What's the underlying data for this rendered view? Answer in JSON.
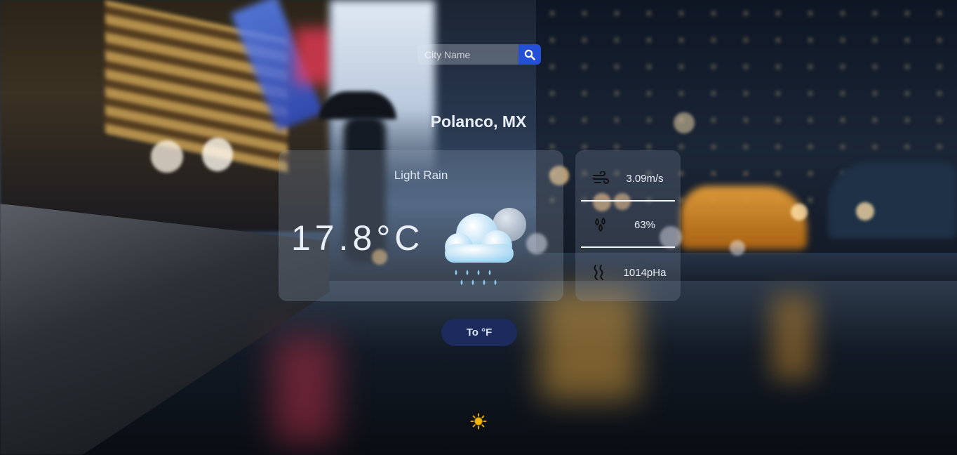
{
  "search": {
    "placeholder": "City Name",
    "value": ""
  },
  "location": {
    "city": "Polanco, MX"
  },
  "weather": {
    "description": "Light Rain",
    "temperature": "17.8°C",
    "icon": "rain-cloud-icon"
  },
  "stats": {
    "wind": {
      "icon": "wind-icon",
      "value": "3.09m/s"
    },
    "humidity": {
      "icon": "humidity-icon",
      "value": "63%"
    },
    "pressure": {
      "icon": "pressure-icon",
      "value": "1014pHa"
    }
  },
  "controls": {
    "unit_toggle_label": "To °F",
    "theme_icon": "sun-icon"
  },
  "colors": {
    "search_button": "#2450d8",
    "toggle_button": "#1c2a5c",
    "sun": "#f2b705"
  }
}
